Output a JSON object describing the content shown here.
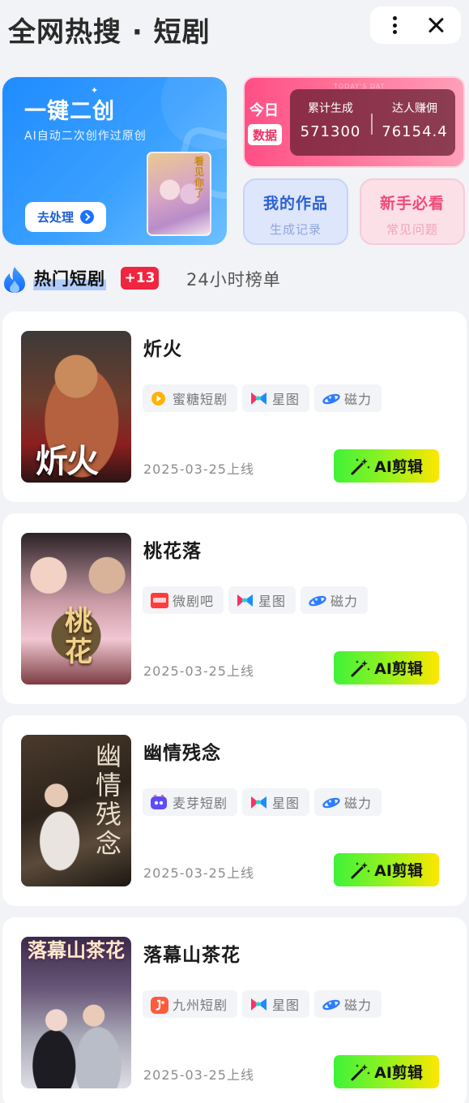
{
  "header": {
    "title": "全网热搜 · 短剧",
    "more_icon": "more-vertical-icon",
    "close_icon": "close-icon"
  },
  "promo": {
    "title": "一键二创",
    "subtitle": "AI自动二次创作过原创",
    "button_label": "去处理",
    "poster_text": "看见你了"
  },
  "stats": {
    "faint_text": "TODAY'S DAT",
    "today_label": "今日",
    "data_tag": "数据",
    "total_label": "累计生成",
    "total_value": "571300",
    "earn_label": "达人赚佣",
    "earn_value": "76154.4"
  },
  "quick_links": {
    "works_title": "我的作品",
    "works_sub": "生成记录",
    "guide_title": "新手必看",
    "guide_sub": "常见问题"
  },
  "tabs": {
    "hot_label": "热门短剧",
    "hot_badge": "+13",
    "rank_label": "24小时榜单"
  },
  "dramas": [
    {
      "name": "炘火",
      "poster_text": "炘火",
      "platforms": [
        "蜜糖短剧",
        "星图",
        "磁力"
      ],
      "platform_icons": [
        "mitang-icon",
        "xingtu-icon",
        "cili-icon"
      ],
      "date": "2025-03-25上线",
      "button_label": "AI剪辑"
    },
    {
      "name": "桃花落",
      "poster_text": "桃花",
      "platforms": [
        "微剧吧",
        "星图",
        "磁力"
      ],
      "platform_icons": [
        "weijuba-icon",
        "xingtu-icon",
        "cili-icon"
      ],
      "date": "2025-03-25上线",
      "button_label": "AI剪辑"
    },
    {
      "name": "幽情残念",
      "poster_text": "幽情残念",
      "platforms": [
        "麦芽短剧",
        "星图",
        "磁力"
      ],
      "platform_icons": [
        "maiya-icon",
        "xingtu-icon",
        "cili-icon"
      ],
      "date": "2025-03-25上线",
      "button_label": "AI剪辑"
    },
    {
      "name": "落幕山茶花",
      "poster_text": "落幕山茶花",
      "platforms": [
        "九州短剧",
        "星图",
        "磁力"
      ],
      "platform_icons": [
        "jiuzhou-icon",
        "xingtu-icon",
        "cili-icon"
      ],
      "date": "2025-03-25上线",
      "button_label": "AI剪辑"
    }
  ],
  "colors": {
    "accent_blue": "#1f8bff",
    "accent_pink": "#ff4f86",
    "badge_red": "#f0253f",
    "ai_button_start": "#3ff23a",
    "ai_button_end": "#ffe600"
  }
}
